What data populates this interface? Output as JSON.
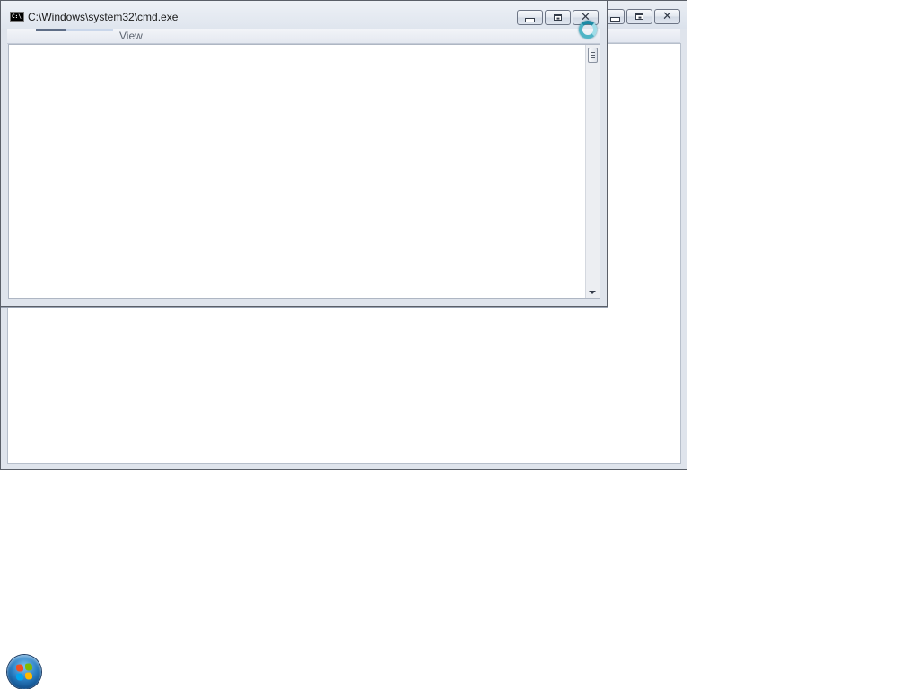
{
  "background_window": {
    "title": ""
  },
  "cmd_window": {
    "title": "C:\\Windows\\system32\\cmd.exe",
    "icon_label": "C:\\",
    "icon": "console-icon",
    "menu": {
      "view_label": "View"
    },
    "controls": {
      "minimize_icon": "minimize-icon",
      "maximize_icon": "maximize-icon",
      "close_icon": "close-icon"
    }
  },
  "cursor": {
    "state": "busy",
    "icon": "busy-spinner-icon"
  },
  "taskbar": {
    "start_icon": "windows-start-orb-icon"
  },
  "colors": {
    "chrome": "#dfe4ec",
    "client": "#ffffff",
    "busy_cursor": "#4fb4c6"
  }
}
